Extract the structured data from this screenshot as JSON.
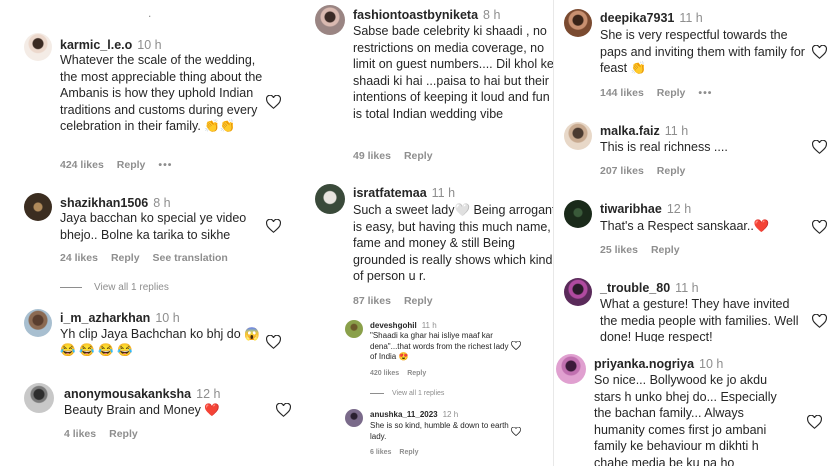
{
  "col1": {
    "top_dot": ".",
    "c1": {
      "user": "karmic_l.e.o",
      "time": "10 h",
      "text": "Whatever the scale of the wedding, the most appreciable thing about the Ambanis is how they uphold Indian traditions and customs during every celebration in their family. 👏👏",
      "likes": "424 likes",
      "reply": "Reply",
      "more": "•••"
    },
    "c2": {
      "user": "shazikhan1506",
      "time": "8 h",
      "text": "Jaya bacchan ko special ye video bhejo.. Bolne ka tarika to sikhe",
      "likes": "24 likes",
      "reply": "Reply",
      "translate": "See translation",
      "view_replies": "View all 1 replies"
    },
    "c3": {
      "user": "i_m_azharkhan",
      "time": "10 h",
      "text": "Yh clip Jaya Bachchan ko bhj do 😱",
      "emojis": "😂 😂 😂 😂"
    },
    "c4": {
      "user": "anonymousakanksha",
      "time": "12 h",
      "text": "Beauty Brain and Money ❤️",
      "likes": "4 likes",
      "reply": "Reply"
    }
  },
  "col2": {
    "c1": {
      "user": "fashiontoastbyniketa",
      "time": "8 h",
      "text": "Sabse bade celebrity ki shaadi , no restrictions on media coverage, no limit on guest numbers.... Dil khol ke shaadi ki hai ...paisa to hai but their intentions of keeping it loud and fun is total Indian wedding vibe",
      "likes": "49 likes",
      "reply": "Reply"
    },
    "c2": {
      "user": "isratfatemaa",
      "time": "11 h",
      "text": "Such a sweet lady🤍 Being arrogant is easy, but having this much name, fame and money & still Being grounded is really shows which kind of person u r.",
      "likes": "87 likes",
      "reply": "Reply"
    },
    "r1": {
      "user": "deveshgohil",
      "time": "11 h",
      "text": "\"Shaadi ka ghar hai isliye maaf kar dena\"...that words from the richest lady of India 😍",
      "likes": "420 likes",
      "reply": "Reply",
      "view_replies": "View all 1 replies"
    },
    "r2": {
      "user": "anushka_11_2023",
      "time": "12 h",
      "text": "She is so kind, humble & down to earth lady.",
      "likes": "6 likes",
      "reply": "Reply"
    }
  },
  "col3": {
    "c1": {
      "user": "deepika7931",
      "time": "11 h",
      "text": "She is very respectful towards the paps and inviting them with family for feast 👏",
      "likes": "144 likes",
      "reply": "Reply",
      "more": "•••"
    },
    "c2": {
      "user": "malka.faiz",
      "time": "11 h",
      "text": "This is real richness ....",
      "likes": "207 likes",
      "reply": "Reply"
    },
    "c3": {
      "user": "tiwaribhae",
      "time": "12 h",
      "text": "That's a Respect sanskaar..❤️",
      "likes": "25 likes",
      "reply": "Reply"
    },
    "c4": {
      "user": "_trouble_80",
      "time": "11 h",
      "text": "What a gesture! They have invited the media people with families. Well done! Huge respect!"
    },
    "c5": {
      "user": "priyanka.nogriya",
      "time": "10 h",
      "text": "So nice... Bollywood ke jo akdu stars h unko bhej do... Especially the bachan family... Always humanity comes first jo ambani family ke behaviour m dikhti h chahe media be ku na ho"
    }
  },
  "colors": {
    "text": "#262626",
    "secondary": "#8e8e8e",
    "heart_red": "#ed4956"
  }
}
